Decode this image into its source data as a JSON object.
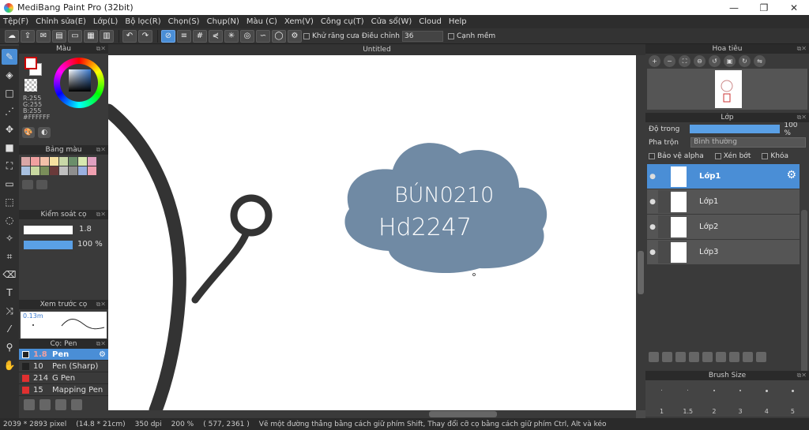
{
  "window": {
    "title": "MediBang Paint Pro (32bit)",
    "min": "—",
    "max": "❐",
    "close": "✕"
  },
  "menu": [
    "Tệp(F)",
    "Chỉnh sửa(E)",
    "Lớp(L)",
    "Bộ lọc(R)",
    "Chọn(S)",
    "Chụp(N)",
    "Màu (C)",
    "Xem(V)",
    "Công cụ(T)",
    "Cửa sổ(W)",
    "Cloud",
    "Help"
  ],
  "toolbar": {
    "antialias_label": "Khử răng cưa",
    "adjust_label": "Điều chỉnh",
    "adjust_value": "36",
    "snap_label": "Cạnh mềm"
  },
  "color_panel": {
    "title": "Màu",
    "r": "R:255",
    "g": "G:255",
    "b": "B:255",
    "hex": "#FFFFFF"
  },
  "palette": {
    "title": "Bảng màu",
    "colors": [
      "#d9a7a7",
      "#f0a0a0",
      "#f3c0a8",
      "#f5e0a0",
      "#c8d8a8",
      "#6a8e6a",
      "#d8e8b0",
      "#e0a0c0",
      "#a8c0e0",
      "#c8d8a0",
      "#7a8e5a",
      "#6a3a3a",
      "#c0c0c0",
      "#8e8e8e",
      "#9ab0e0",
      "#f0a0b0"
    ]
  },
  "brush_control": {
    "title": "Kiểm soát cọ",
    "size": "1.8",
    "opacity": "100 %"
  },
  "brush_preview": {
    "title": "Xem trước cọ",
    "size": "0.13m"
  },
  "brushes": {
    "title": "Cọ: Pen",
    "items": [
      {
        "size": "1.8",
        "name": "Pen",
        "color": "#222222"
      },
      {
        "size": "10",
        "name": "Pen (Sharp)",
        "color": "#222222"
      },
      {
        "size": "214",
        "name": "G Pen",
        "color": "#e03030"
      },
      {
        "size": "15",
        "name": "Mapping Pen",
        "color": "#e03030"
      }
    ]
  },
  "canvas": {
    "title": "Untitled",
    "text_line1": "BÚN0210",
    "text_line2": "Hd2247",
    "cloud_color": "#708aa4"
  },
  "navigator": {
    "title": "Hoa tiêu"
  },
  "layers": {
    "title": "Lớp",
    "opacity_label": "Độ trong",
    "opacity_value": "100 %",
    "blend_label": "Pha trộn",
    "blend_value": "Bình thường",
    "protect_alpha": "Bảo vệ alpha",
    "clipping": "Xén bớt",
    "lock": "Khóa",
    "items": [
      {
        "name": "Lớp1",
        "selected": true
      },
      {
        "name": "Lớp1",
        "selected": false
      },
      {
        "name": "Lớp2",
        "selected": false
      },
      {
        "name": "Lớp3",
        "selected": false
      }
    ]
  },
  "brush_size": {
    "title": "Brush Size",
    "values": [
      "1",
      "1.5",
      "2",
      "3",
      "4",
      "5"
    ]
  },
  "status": {
    "pixels": "2039 * 2893 pixel",
    "cm": "(14.8 * 21cm)",
    "dpi": "350 dpi",
    "zoom": "200 %",
    "coords": "( 577, 2361 )",
    "hint": "Vẽ một đường thẳng bằng cách giữ phím Shift, Thay đổi cỡ cọ bằng cách giữ phím Ctrl, Alt và kéo"
  }
}
